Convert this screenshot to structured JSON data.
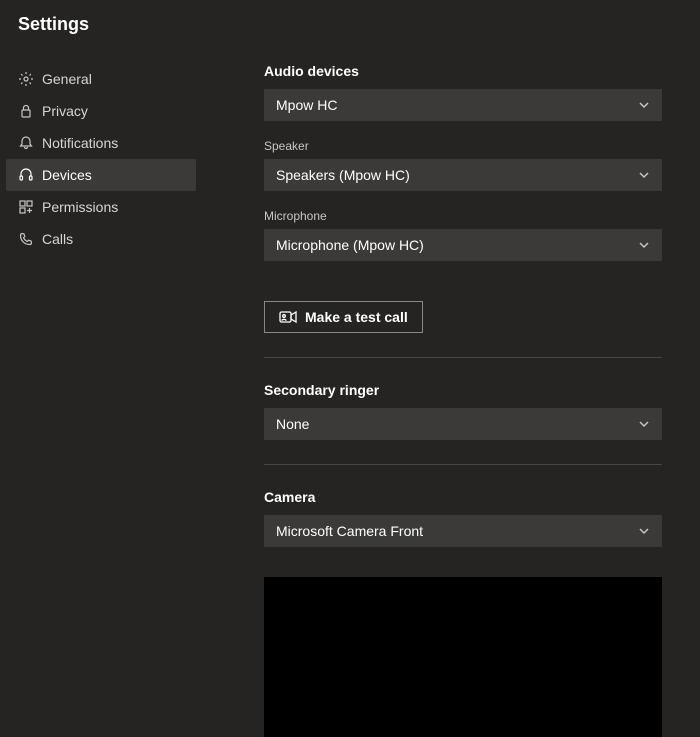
{
  "page_title": "Settings",
  "sidebar": {
    "items": [
      {
        "label": "General",
        "icon": "gear"
      },
      {
        "label": "Privacy",
        "icon": "lock"
      },
      {
        "label": "Notifications",
        "icon": "bell"
      },
      {
        "label": "Devices",
        "icon": "headset"
      },
      {
        "label": "Permissions",
        "icon": "app"
      },
      {
        "label": "Calls",
        "icon": "phone"
      }
    ],
    "active_index": 3
  },
  "content": {
    "audio_devices": {
      "heading": "Audio devices",
      "main_value": "Mpow HC",
      "speaker_label": "Speaker",
      "speaker_value": "Speakers (Mpow HC)",
      "microphone_label": "Microphone",
      "microphone_value": "Microphone (Mpow HC)",
      "test_call_label": "Make a test call"
    },
    "secondary_ringer": {
      "heading": "Secondary ringer",
      "value": "None"
    },
    "camera": {
      "heading": "Camera",
      "value": "Microsoft Camera Front"
    }
  }
}
